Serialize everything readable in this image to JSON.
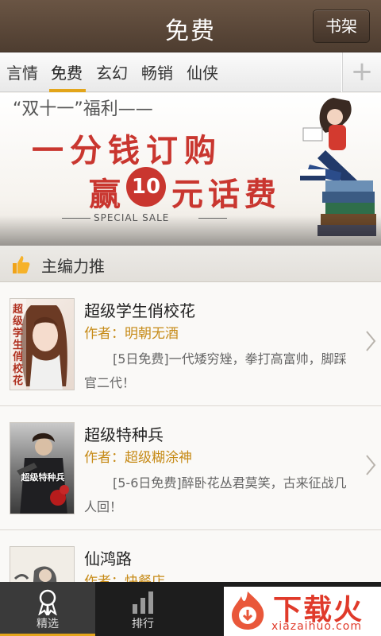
{
  "header": {
    "title": "免费",
    "shelf_label": "书架"
  },
  "tabs": [
    {
      "label": "言情"
    },
    {
      "label": "免费",
      "active": true
    },
    {
      "label": "玄幻"
    },
    {
      "label": "畅销"
    },
    {
      "label": "仙侠"
    }
  ],
  "tabs_add_icon": "plus-icon",
  "banner": {
    "pre": "“双十一”福利——",
    "line1": "一分钱订购",
    "line2_prefix": "赢",
    "line2_number": "10",
    "line2_suffix": "元话费",
    "sub": "SPECIAL SALE"
  },
  "section": {
    "title": "主编力推",
    "icon": "thumbs-up-icon"
  },
  "books": [
    {
      "title": "超级学生俏校花",
      "author": "作者：明朝无酒",
      "desc": "[5日免费]一代矮穷矬，拳打高富帅，脚踩官二代！",
      "cover_text": "超级学生俏校花"
    },
    {
      "title": "超级特种兵",
      "author": "作者：超级糊涂神",
      "desc": "[5-6日免费]醉卧花丛君莫笑，古来征战几人回！",
      "cover_text": "超级特种兵"
    },
    {
      "title": "仙鸿路",
      "author": "作者：快餐店",
      "desc": "",
      "cover_text": ""
    }
  ],
  "bottom_nav": [
    {
      "label": "精选",
      "icon": "ribbon-icon",
      "active": true
    },
    {
      "label": "排行",
      "icon": "bar-chart-icon"
    }
  ],
  "watermark": {
    "text": "下载火",
    "url": "xiazaihuo.com"
  },
  "colors": {
    "header_bg": "#5a4637",
    "accent": "#e3a51a",
    "author": "#c68a16",
    "promo_red": "#c9362f"
  }
}
